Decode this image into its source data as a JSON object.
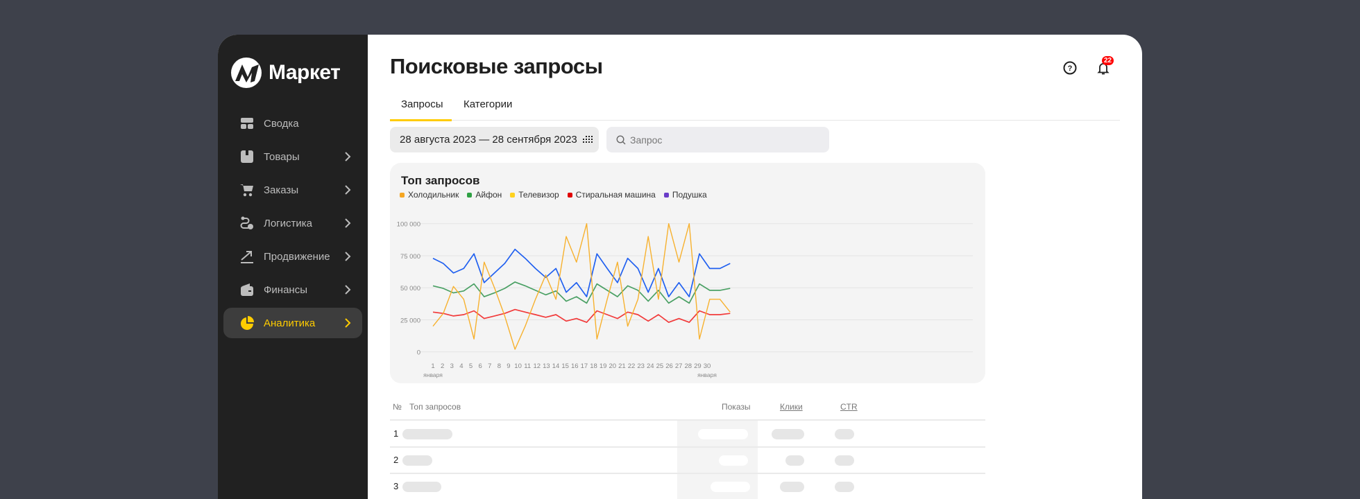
{
  "brand": {
    "name": "Маркет"
  },
  "sidebar": {
    "items": [
      {
        "label": "Сводка",
        "icon": "dashboard-icon",
        "chevron": false,
        "active": false
      },
      {
        "label": "Товары",
        "icon": "box-icon",
        "chevron": true,
        "active": false
      },
      {
        "label": "Заказы",
        "icon": "cart-icon",
        "chevron": true,
        "active": false
      },
      {
        "label": "Логистика",
        "icon": "route-icon",
        "chevron": true,
        "active": false
      },
      {
        "label": "Продвижение",
        "icon": "trend-up-icon",
        "chevron": true,
        "active": false
      },
      {
        "label": "Финансы",
        "icon": "wallet-icon",
        "chevron": true,
        "active": false
      },
      {
        "label": "Аналитика",
        "icon": "pie-chart-icon",
        "chevron": true,
        "active": true
      }
    ]
  },
  "header": {
    "title": "Поисковые запросы",
    "notifications_count": "22"
  },
  "tabs": [
    {
      "label": "Запросы",
      "active": true
    },
    {
      "label": "Категории",
      "active": false
    }
  ],
  "filters": {
    "date_range": "28 августа 2023 — 28 сентября 2023",
    "search_placeholder": "Запрос"
  },
  "chart_data": {
    "type": "line",
    "title": "Топ запросов",
    "legend": [
      {
        "name": "Холодильник",
        "color": "#f5a623"
      },
      {
        "name": "Айфон",
        "color": "#2ea043"
      },
      {
        "name": "Телевизор",
        "color": "#ffd21f"
      },
      {
        "name": "Стиральная машина",
        "color": "#e00000"
      },
      {
        "name": "Подушка",
        "color": "#6a3dc8"
      }
    ],
    "yticks": [
      "100 000",
      "75 000",
      "50 000",
      "25 000",
      "0"
    ],
    "ylim": [
      0,
      100000
    ],
    "xticks": [
      "1",
      "2",
      "3",
      "4",
      "5",
      "6",
      "7",
      "8",
      "9",
      "10",
      "11",
      "12",
      "13",
      "14",
      "15",
      "16",
      "17",
      "18",
      "19",
      "20",
      "21",
      "22",
      "23",
      "24",
      "25",
      "26",
      "27",
      "28",
      "29",
      "30"
    ],
    "xsub": {
      "first": "января",
      "last": "января"
    },
    "series": [
      {
        "name": "blue",
        "color": "#2060f0",
        "values": [
          73000,
          69000,
          61500,
          65000,
          76500,
          54000,
          61500,
          69000,
          80000,
          73000,
          65000,
          58000,
          65000,
          46500,
          54000,
          43000,
          76500,
          65000,
          54000,
          73000,
          65000,
          46500,
          65000,
          43000,
          54000,
          43000,
          76500,
          65000,
          65000,
          69000
        ]
      },
      {
        "name": "green",
        "color": "#4aa064",
        "values": [
          51500,
          49500,
          46000,
          47500,
          53000,
          43000,
          46000,
          49500,
          54500,
          51500,
          48000,
          44500,
          47500,
          39500,
          43000,
          38000,
          53000,
          48000,
          43000,
          51500,
          48000,
          39500,
          48000,
          38000,
          43000,
          38000,
          53000,
          48000,
          48000,
          49500
        ]
      },
      {
        "name": "red",
        "color": "#f23a3a",
        "values": [
          31000,
          30000,
          28000,
          29000,
          32000,
          26000,
          28000,
          30000,
          33000,
          31000,
          29000,
          27000,
          29000,
          24000,
          26000,
          23000,
          32000,
          29000,
          26000,
          31000,
          29000,
          24000,
          29000,
          23000,
          26000,
          23000,
          32000,
          29000,
          29000,
          30000
        ]
      },
      {
        "name": "orange",
        "color": "#f7b12e",
        "values": [
          20000,
          30000,
          51000,
          41000,
          10000,
          70000,
          50000,
          28000,
          2000,
          20000,
          41000,
          60000,
          41000,
          90000,
          70000,
          100000,
          10000,
          41000,
          70000,
          20000,
          41000,
          90000,
          41000,
          100000,
          70000,
          100000,
          10000,
          41000,
          41000,
          31000
        ]
      }
    ]
  },
  "table": {
    "columns": {
      "num": "№",
      "query": "Топ запросов",
      "shows": "Показы",
      "clicks": "Клики",
      "ctr": "CTR"
    },
    "rows": [
      {
        "num": "1"
      },
      {
        "num": "2"
      },
      {
        "num": "3"
      }
    ]
  }
}
